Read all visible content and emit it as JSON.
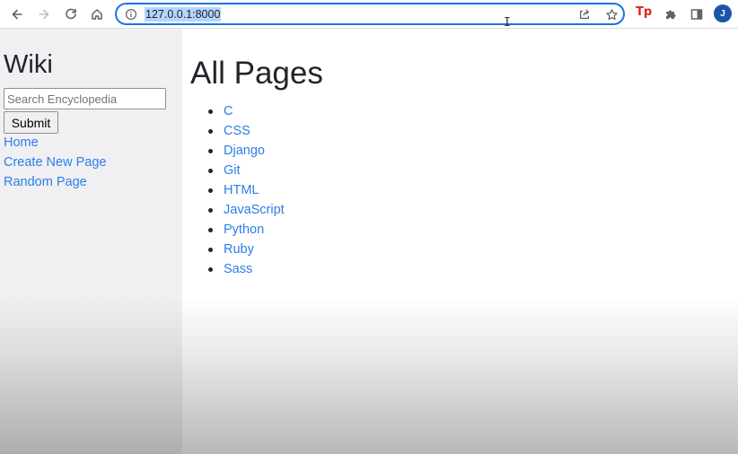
{
  "browser": {
    "url": "127.0.0.1:8000",
    "extension_tp_label": "Tp",
    "profile_initial": "J",
    "icons": [
      "back-icon",
      "forward-icon",
      "reload-icon",
      "home-icon",
      "info-icon",
      "share-icon",
      "star-icon",
      "puzzle-icon",
      "side-panel-icon"
    ]
  },
  "sidebar": {
    "title": "Wiki",
    "search": {
      "placeholder": "Search Encyclopedia",
      "value": ""
    },
    "submit_label": "Submit",
    "links": [
      "Home",
      "Create New Page",
      "Random Page"
    ]
  },
  "main": {
    "title": "All Pages",
    "pages": [
      "C",
      "CSS",
      "Django",
      "Git",
      "HTML",
      "JavaScript",
      "Python",
      "Ruby",
      "Sass"
    ]
  },
  "colors": {
    "link": "#2b7de9",
    "sidebar_bg": "#f0f0f2",
    "omnibox_focus": "#1a73e8",
    "url_selection": "#b4d5fe",
    "avatar": "#1a56a8"
  }
}
